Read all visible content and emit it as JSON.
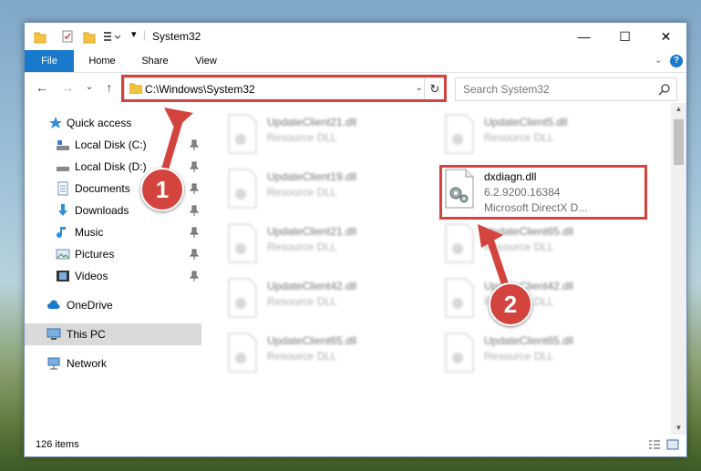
{
  "window": {
    "title": "System32",
    "controls": {
      "minimize": "—",
      "maximize": "☐",
      "close": "✕"
    }
  },
  "ribbon": {
    "tabs": [
      "File",
      "Home",
      "Share",
      "View"
    ],
    "expand": "⌄",
    "help": "?"
  },
  "nav": {
    "back": "←",
    "forward": "→",
    "recent": "⌄",
    "up": "↑",
    "address": "C:\\Windows\\System32",
    "address_dropdown": "⌄",
    "refresh": "↻",
    "search_placeholder": "Search System32"
  },
  "sidebar": {
    "items": [
      {
        "label": "Quick access",
        "icon": "star-icon",
        "pinned": false
      },
      {
        "label": "Local Disk (C:)",
        "icon": "drive-icon",
        "pinned": true
      },
      {
        "label": "Local Disk (D:)",
        "icon": "drive-icon",
        "pinned": true
      },
      {
        "label": "Documents",
        "icon": "document-icon",
        "pinned": true
      },
      {
        "label": "Downloads",
        "icon": "download-icon",
        "pinned": true
      },
      {
        "label": "Music",
        "icon": "music-icon",
        "pinned": true
      },
      {
        "label": "Pictures",
        "icon": "pictures-icon",
        "pinned": true
      },
      {
        "label": "Videos",
        "icon": "videos-icon",
        "pinned": true
      },
      {
        "label": "OneDrive",
        "icon": "cloud-icon",
        "pinned": false
      },
      {
        "label": "This PC",
        "icon": "computer-icon",
        "pinned": false,
        "selected": true
      },
      {
        "label": "Network",
        "icon": "network-icon",
        "pinned": false
      }
    ]
  },
  "files": {
    "left": [
      {
        "name": "UpdateClient21.dll",
        "type": "Resource DLL"
      },
      {
        "name": "UpdateClient19.dll",
        "type": "Resource DLL"
      },
      {
        "name": "UpdateClient21.dll",
        "type": "Resource DLL"
      },
      {
        "name": "UpdateClient42.dll",
        "type": "Resource DLL"
      },
      {
        "name": "UpdateClient65.dll",
        "type": "Resource DLL"
      }
    ],
    "right": [
      {
        "name": "UpdateClient5.dll",
        "type": "Resource DLL"
      },
      {
        "name": "UpdateClient65.dll",
        "type": "Resource DLL"
      },
      {
        "name": "UpdateClient42.dll",
        "type": "Resource DLL"
      },
      {
        "name": "UpdateClient65.dll",
        "type": "Resource DLL"
      }
    ],
    "focus": {
      "name": "dxdiagn.dll",
      "version": "6.2.9200.16384",
      "description": "Microsoft DirectX D..."
    }
  },
  "status": {
    "count": "126 items"
  },
  "callouts": {
    "one": "1",
    "two": "2"
  },
  "colors": {
    "accent": "#1979ca",
    "highlight": "#d3443f"
  }
}
